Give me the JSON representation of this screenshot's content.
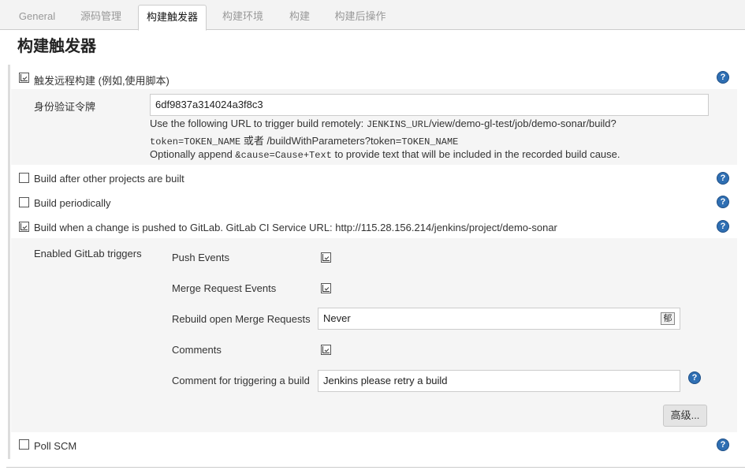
{
  "tabs": [
    "General",
    "源码管理",
    "构建触发器",
    "构建环境",
    "构建",
    "构建后操作"
  ],
  "section_title": "构建触发器",
  "remote_trigger": {
    "label": "触发远程构建 (例如,使用脚本)",
    "checked": true,
    "token_label": "身份验证令牌",
    "token_value": "6df9837a314024a3f8c3",
    "line1_prefix": "Use the following URL to trigger build remotely: ",
    "line1_code": "JENKINS_URL",
    "line1_suffix": "/view/demo-gl-test/job/demo-sonar/build?",
    "line2_code1": "token=TOKEN_NAME",
    "line2_mid": " 或者 /buildWithParameters?token=",
    "line2_code2": "TOKEN_NAME",
    "line3_prefix": "Optionally append ",
    "line3_code": "&cause=Cause+Text",
    "line3_suffix": " to provide text that will be included in the recorded build cause."
  },
  "triggers": {
    "after_other": "Build after other projects are built",
    "periodically": "Build periodically",
    "gitlab": "Build when a change is pushed to GitLab. GitLab CI Service URL: http://115.28.156.214/jenkins/project/demo-sonar",
    "poll_scm": "Poll SCM"
  },
  "gitlab": {
    "enabled_label": "Enabled GitLab triggers",
    "push_events": "Push Events",
    "merge_request_events": "Merge Request Events",
    "rebuild_label": "Rebuild open Merge Requests",
    "rebuild_value": "Never",
    "rebuild_arrow": "郁",
    "comments": "Comments",
    "comment_trigger_label": "Comment for triggering a build",
    "comment_trigger_value": "Jenkins please retry a build",
    "advanced_button": "高级..."
  },
  "help_glyph": "?",
  "icons": [
    "help-icon",
    "checkbox-checked",
    "checkbox-unchecked"
  ],
  "colors": {
    "help_blue": "#2f6fb3",
    "panel_bg": "#f5f5f5",
    "tab_bg": "#f3f3f3"
  }
}
